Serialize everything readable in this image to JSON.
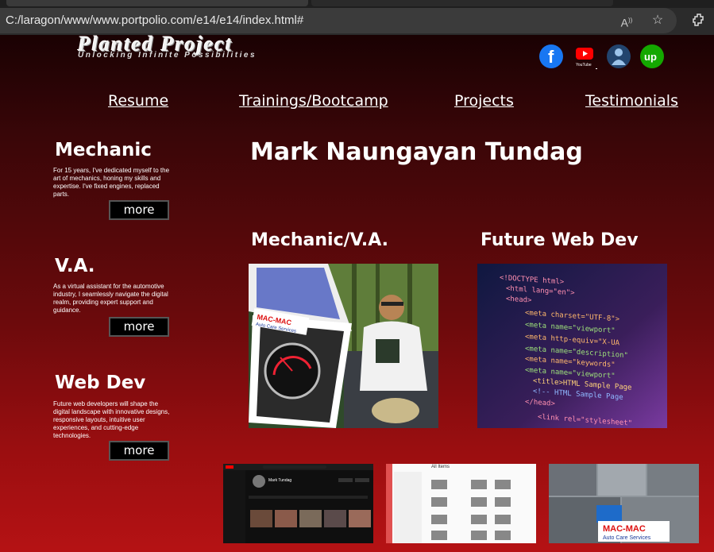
{
  "browser": {
    "url": "C:/laragon/www/www.portpolio.com/e14/e14/index.html#",
    "read_aloud_label": "A",
    "icons": [
      "read-aloud-icon",
      "favorite-star-icon",
      "extensions-icon"
    ]
  },
  "header": {
    "logo_title": "Planted Project",
    "logo_subtitle": "Unlocking Infinite Possibilities",
    "social": [
      {
        "name": "facebook-icon",
        "color": "#1877f2",
        "glyph": "f"
      },
      {
        "name": "youtube-icon",
        "color": "#ff0000",
        "glyph": "▶",
        "caption": "YouTube"
      },
      {
        "name": "onlinejobs-icon",
        "color": "#1d3c6e",
        "glyph": "👤"
      },
      {
        "name": "upwork-icon",
        "color": "#14a800",
        "glyph": "up"
      }
    ]
  },
  "nav": {
    "resume": "Resume",
    "trainings": "Trainings/Bootcamp",
    "projects": "Projects",
    "testimonials": "Testimonials"
  },
  "sidebar": {
    "mechanic": {
      "title": "Mechanic",
      "text": "For 15 years, I've dedicated myself to the art of mechanics, honing my skills and expertise. I've fixed engines, replaced parts.",
      "button": "more"
    },
    "va": {
      "title": "V.A.",
      "text": "As a virtual assistant for the automotive industry, I seamlessly navigate the digital realm, providing expert support and guidance.",
      "button": "more"
    },
    "webdev": {
      "title": "Web Dev",
      "text": "Future web developers will shape the digital landscape with innovative designs, responsive layouts, intuitive user experiences, and cutting-edge technologies.",
      "button": "more"
    }
  },
  "main": {
    "name": "Mark Naungayan Tundag",
    "col1_title": "Mechanic/V.A.",
    "col2_title": "Future Web Dev",
    "photo_sign_line1": "MAC-MAC",
    "photo_sign_line2": "Auto Care Services",
    "code_lines": [
      "<!DOCTYPE html>",
      "<html lang=\"en\">",
      "<head>",
      "<meta charset=\"UTF-8\">",
      "<meta name=\"viewport\"",
      "<meta http-equiv=\"X-UA",
      "<meta name=\"description\"",
      "<meta name=\"keywords\"",
      "<meta name=\"viewport\"",
      "<title>HTML Sample Page",
      "<!-- HTML Sample Page",
      "</head>",
      "<link rel=\"stylesheet\""
    ]
  },
  "thumbnails": {
    "yt_channel": "Mark Tundag",
    "all_items_title": "All Items",
    "mac_sign_line1": "MAC-MAC",
    "mac_sign_line2": "Auto Care Services"
  }
}
